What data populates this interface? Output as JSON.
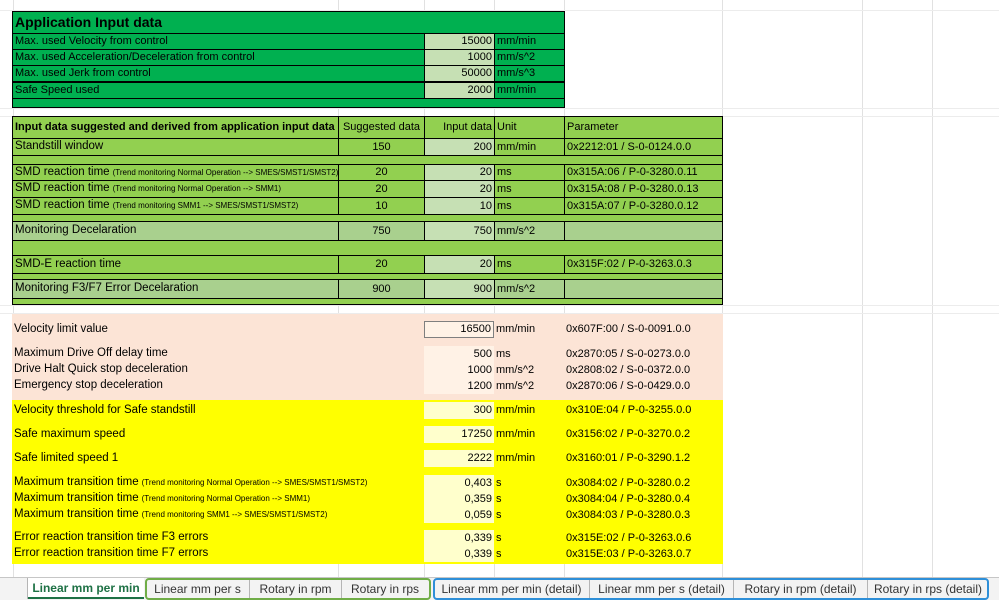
{
  "colors": {
    "dark_green": "#00b050",
    "green": "#92d050",
    "light_green": "#a9d08e",
    "input_green": "#c6e0b4",
    "peach": "#fce4d6",
    "peach_input": "#fff2e6",
    "yellow": "#ffff00",
    "yellow_input": "#ffffcc",
    "tab_group_green": "#70ad47",
    "tab_group_blue": "#2e8fd8"
  },
  "app_input": {
    "title": "Application Input data",
    "rows": [
      {
        "label": "Max. used Velocity from control",
        "value": "15000",
        "unit": "mm/min"
      },
      {
        "label": "Max. used Acceleration/Deceleration from control",
        "value": "1000",
        "unit": "mm/s^2"
      },
      {
        "label": "Max. used Jerk from control",
        "value": "50000",
        "unit": "mm/s^3"
      },
      {
        "label": "Safe Speed used",
        "value": "2000",
        "unit": "mm/min"
      }
    ]
  },
  "derived": {
    "header": {
      "label": "Input data suggested and derived from application input data",
      "suggested": "Suggested data",
      "input": "Input data",
      "unit": "Unit",
      "parameter": "Parameter"
    },
    "rows": [
      {
        "label": "Standstill window",
        "note": "",
        "suggested": "150",
        "value": "200",
        "unit": "mm/min",
        "param": "0x2212:01 / S-0-0124.0.0"
      },
      {
        "label": "SMD reaction time",
        "note": "(Trend monitoring Normal Operation --> SMES/SMST1/SMST2)",
        "suggested": "20",
        "value": "20",
        "unit": "ms",
        "param": "0x315A:06 / P-0-3280.0.11"
      },
      {
        "label": "SMD reaction time",
        "note": "(Trend monitoring Normal Operation --> SMM1)",
        "suggested": "20",
        "value": "20",
        "unit": "ms",
        "param": "0x315A:08 / P-0-3280.0.13"
      },
      {
        "label": "SMD reaction time",
        "note": "(Trend monitoring SMM1 --> SMES/SMST1/SMST2)",
        "suggested": "10",
        "value": "10",
        "unit": "ms",
        "param": "0x315A:07 / P-0-3280.0.12"
      },
      {
        "label": "Monitoring Decelaration",
        "note": "",
        "suggested": "750",
        "value": "750",
        "unit": "mm/s^2",
        "param": ""
      },
      {
        "label": "SMD-E reaction time",
        "note": "",
        "suggested": "20",
        "value": "20",
        "unit": "ms",
        "param": "0x315F:02 / P-0-3263.0.3"
      },
      {
        "label": "Monitoring F3/F7 Error Decelaration",
        "note": "",
        "suggested": "900",
        "value": "900",
        "unit": "mm/s^2",
        "param": ""
      }
    ]
  },
  "peach_rows": [
    {
      "label": "Velocity limit value",
      "value": "16500",
      "unit": "mm/min",
      "param": "0x607F:00 / S-0-0091.0.0"
    },
    {
      "label": "Maximum Drive Off delay time",
      "value": "500",
      "unit": "ms",
      "param": "0x2870:05 / S-0-0273.0.0"
    },
    {
      "label": "Drive Halt Quick stop deceleration",
      "value": "1000",
      "unit": "mm/s^2",
      "param": "0x2808:02 / S-0-0372.0.0"
    },
    {
      "label": "Emergency stop deceleration",
      "value": "1200",
      "unit": "mm/s^2",
      "param": "0x2870:06 / S-0-0429.0.0"
    }
  ],
  "yellow_rows": [
    {
      "label": "Velocity threshold for Safe standstill",
      "note": "",
      "value": "300",
      "unit": "mm/min",
      "param": "0x310E:04 / P-0-3255.0.0"
    },
    {
      "label": "Safe maximum speed",
      "note": "",
      "value": "17250",
      "unit": "mm/min",
      "param": "0x3156:02 / P-0-3270.0.2"
    },
    {
      "label": "Safe limited speed 1",
      "note": "",
      "value": "2222",
      "unit": "mm/min",
      "param": "0x3160:01 / P-0-3290.1.2"
    },
    {
      "label": "Maximum transition time",
      "note": "(Trend monitoring Normal Operation --> SMES/SMST1/SMST2)",
      "value": "0,403",
      "unit": "s",
      "param": "0x3084:02 / P-0-3280.0.2"
    },
    {
      "label": "Maximum transition time",
      "note": "(Trend monitoring Normal Operation --> SMM1)",
      "value": "0,359",
      "unit": "s",
      "param": "0x3084:04 / P-0-3280.0.4"
    },
    {
      "label": "Maximum transition time",
      "note": "(Trend monitoring SMM1 --> SMES/SMST1/SMST2)",
      "value": "0,059",
      "unit": "s",
      "param": "0x3084:03 / P-0-3280.0.3"
    },
    {
      "label": "Error reaction transition time F3 errors",
      "note": "",
      "value": "0,339",
      "unit": "s",
      "param": "0x315E:02 / P-0-3263.0.6"
    },
    {
      "label": "Error reaction transition time F7 errors",
      "note": "",
      "value": "0,339",
      "unit": "s",
      "param": "0x315E:03 / P-0-3263.0.7"
    }
  ],
  "tabs": [
    "Linear mm per min",
    "Linear mm per s",
    "Rotary in rpm",
    "Rotary in rps",
    "Linear mm per min (detail)",
    "Linear mm per s (detail)",
    "Rotary in rpm (detail)",
    "Rotary in rps (detail)"
  ]
}
